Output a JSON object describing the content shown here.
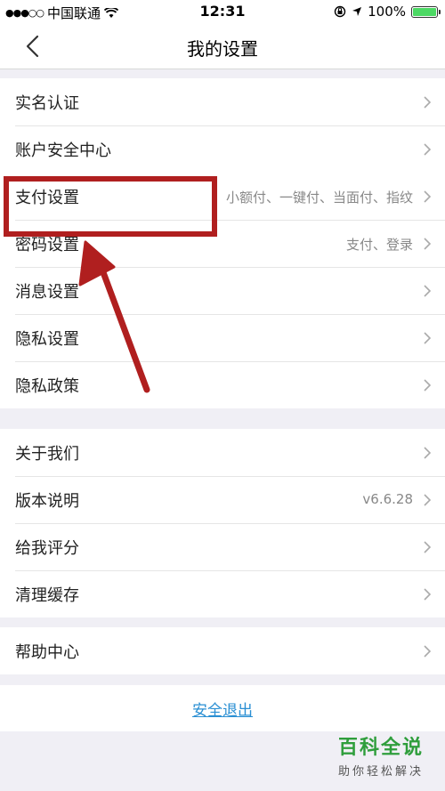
{
  "status_bar": {
    "carrier": "中国联通",
    "time": "12:31",
    "battery": "100%",
    "battery_level": 1.0
  },
  "header": {
    "title": "我的设置"
  },
  "groups": [
    {
      "rows": [
        {
          "label": "实名认证",
          "value": ""
        },
        {
          "label": "账户安全中心",
          "value": ""
        }
      ]
    },
    {
      "rows": [
        {
          "label": "支付设置",
          "value": "小额付、一键付、当面付、指纹"
        },
        {
          "label": "密码设置",
          "value": "支付、登录"
        },
        {
          "label": "消息设置",
          "value": ""
        },
        {
          "label": "隐私设置",
          "value": ""
        },
        {
          "label": "隐私政策",
          "value": ""
        }
      ]
    },
    {
      "rows": [
        {
          "label": "关于我们",
          "value": ""
        },
        {
          "label": "版本说明",
          "value": "v6.6.28"
        },
        {
          "label": "给我评分",
          "value": ""
        },
        {
          "label": "清理缓存",
          "value": ""
        }
      ]
    },
    {
      "rows": [
        {
          "label": "帮助中心",
          "value": ""
        }
      ]
    }
  ],
  "logout": {
    "label": "安全退出"
  },
  "watermark": {
    "main": "百科全说",
    "sub": "助你轻松解决"
  },
  "colors": {
    "annotation": "#b01f1f",
    "link": "#2a8fd3",
    "battery": "#4cd964",
    "watermark": "#2f9e3c"
  }
}
